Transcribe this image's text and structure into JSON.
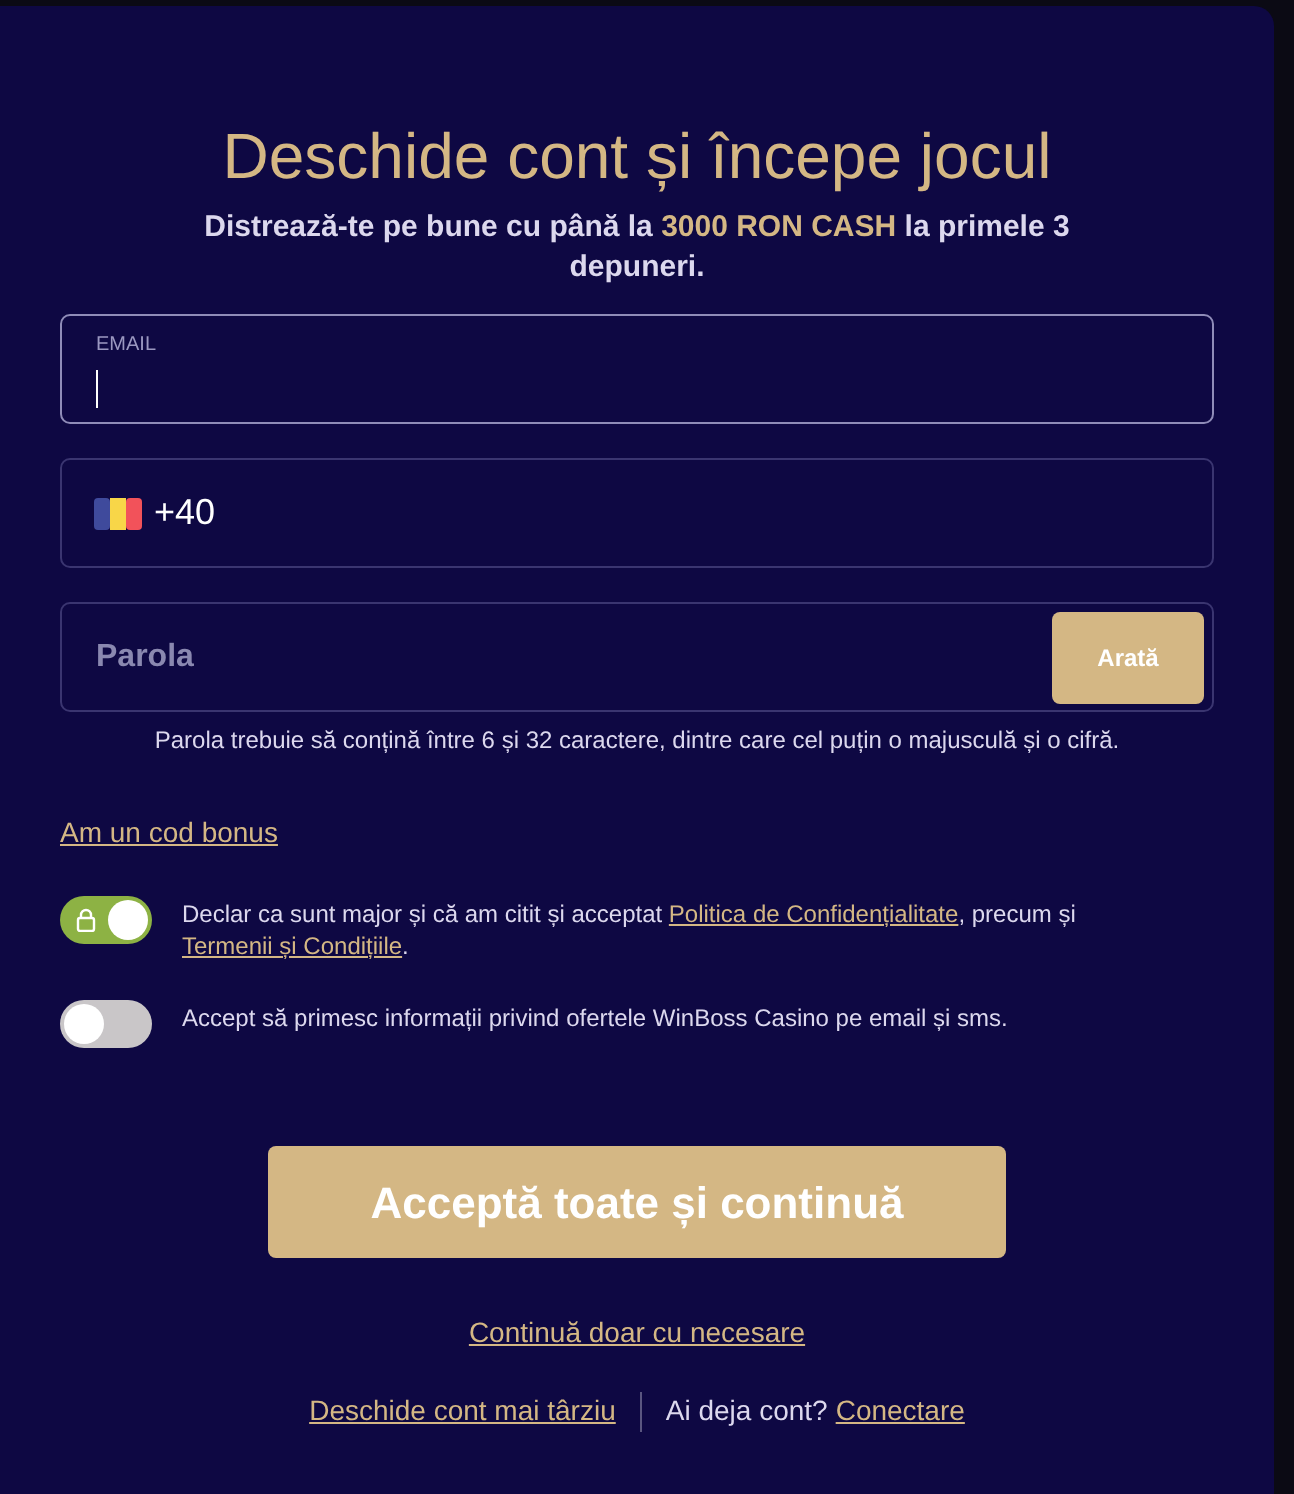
{
  "title": "Deschide cont și începe jocul",
  "subtitle": "Distrează-te pe bune cu până la **3000 RON CASH** la primele 3 depuneri.",
  "email_field": {
    "label": "EMAIL",
    "focused": true
  },
  "phone_field": {
    "value": "+40"
  },
  "password_field": {
    "placeholder": "Parola",
    "button": "Arată"
  },
  "password_hint": "Parola trebuie să conțină între 6 și 32 caractere, dintre care cel puțin o majusculă și o cifră.",
  "bonus_link": "Am un cod bonus",
  "consents": [
    {
      "on": true,
      "locked": true,
      "parts": [
        {
          "kind": "text",
          "text": "Declar ca sunt major și că am citit și acceptat "
        },
        {
          "kind": "link",
          "text": "Politica de Confidențialitate"
        },
        {
          "kind": "text",
          "text": ", precum și "
        },
        {
          "kind": "link",
          "text": "Termenii și Condițiile"
        },
        {
          "kind": "text",
          "text": "."
        }
      ]
    },
    {
      "on": false,
      "locked": false,
      "parts": [
        {
          "kind": "text",
          "text": "Accept să primesc informații privind ofertele WinBoss Casino pe email și sms."
        }
      ]
    }
  ],
  "primary_button": "Acceptă toate și continuă",
  "secondary_link": "Continuă doar cu necesare",
  "footer": {
    "later_link": "Deschide cont mai târziu",
    "question": "Ai deja cont?",
    "login_link": "Conectare"
  }
}
